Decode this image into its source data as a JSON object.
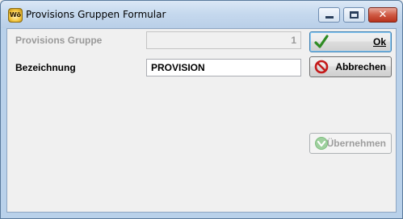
{
  "window": {
    "title": "Provisions Gruppen Formular",
    "app_icon_text": "Wö",
    "minimize": "minimize",
    "maximize": "maximize",
    "close": "close"
  },
  "form": {
    "gruppe": {
      "label": "Provisions Gruppe",
      "value": "1"
    },
    "bezeichnung": {
      "label": "Bezeichnung",
      "value": "PROVISION"
    }
  },
  "buttons": {
    "ok": {
      "label": "Ok",
      "icon": "checkmark-icon",
      "color": "#2e8b22"
    },
    "abbrechen": {
      "label": "Abbrechen",
      "icon": "cancel-icon",
      "color": "#c41a1a"
    },
    "uebernehmen": {
      "label": "Übernehmen",
      "icon": "apply-icon",
      "color": "#7fbf7f"
    }
  }
}
